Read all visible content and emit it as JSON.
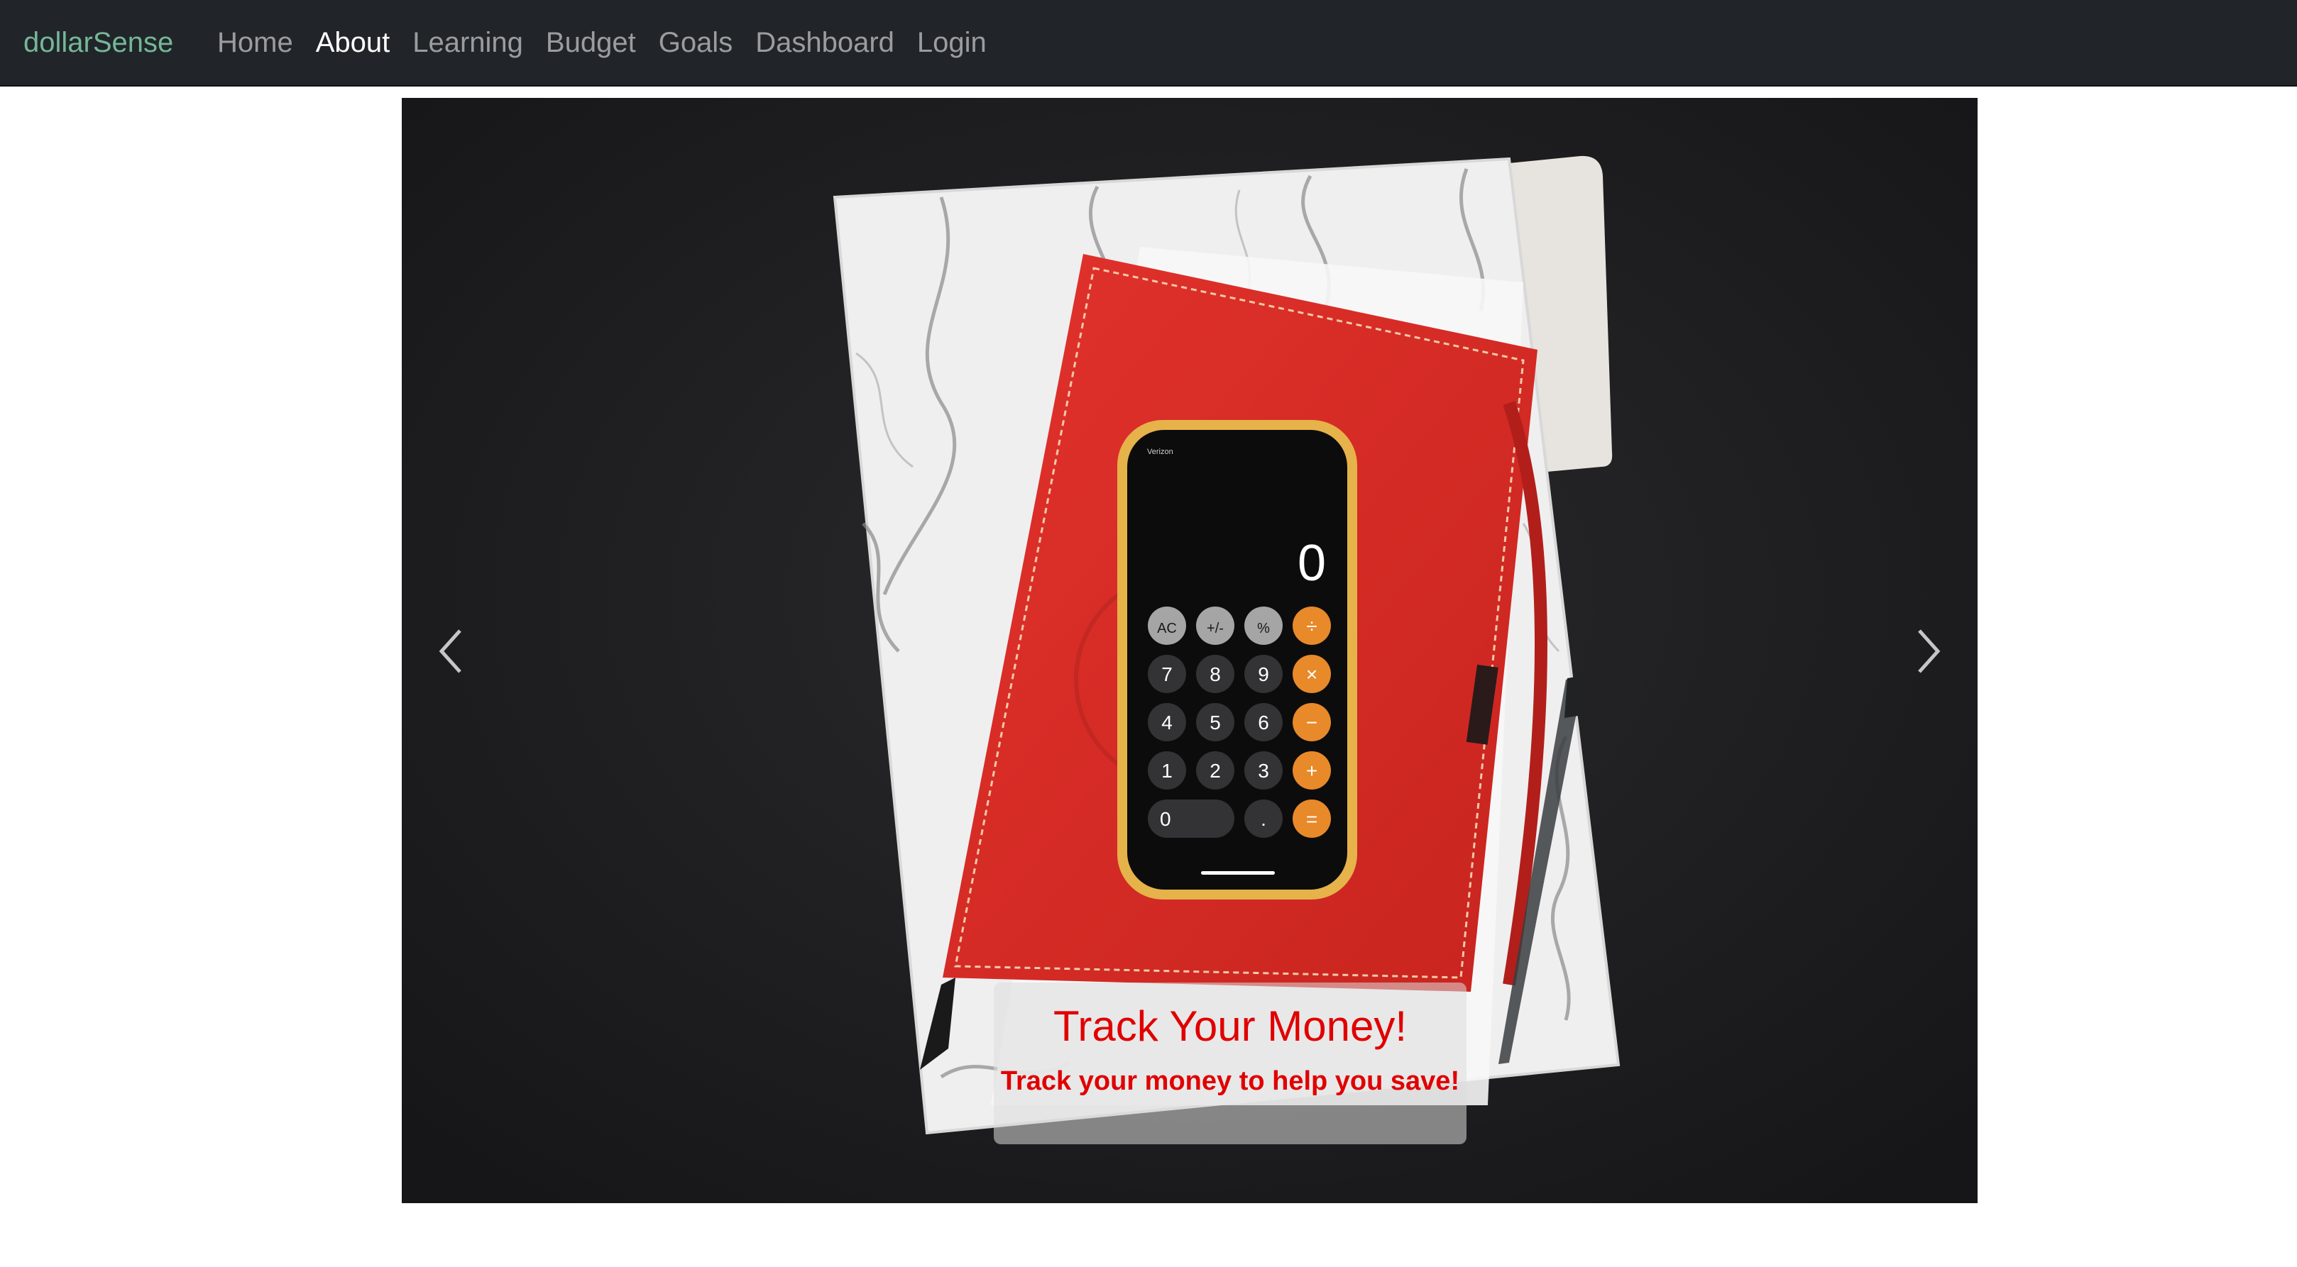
{
  "navbar": {
    "brand": "dollarSense",
    "links": [
      {
        "label": "Home"
      },
      {
        "label": "About",
        "active": true
      },
      {
        "label": "Learning"
      },
      {
        "label": "Budget"
      },
      {
        "label": "Goals"
      },
      {
        "label": "Dashboard"
      },
      {
        "label": "Login"
      }
    ]
  },
  "carousel": {
    "caption_title": "Track Your Money!",
    "caption_text": "Track your money to help you save!",
    "active_slide": 2,
    "slide_count": 3,
    "prev_icon": "chevron-left-icon",
    "next_icon": "chevron-right-icon",
    "phone": {
      "carrier": "Verizon",
      "display": "0",
      "keys": [
        [
          "AC",
          "+/-",
          "%",
          "÷"
        ],
        [
          "7",
          "8",
          "9",
          "×"
        ],
        [
          "4",
          "5",
          "6",
          "−"
        ],
        [
          "1",
          "2",
          "3",
          "+"
        ],
        [
          "0",
          ".",
          "="
        ]
      ]
    }
  },
  "colors": {
    "navbar_bg": "#212529",
    "brand": "#75b798",
    "caption_text": "#e00000",
    "notebook": "#d92b26",
    "calc_orange": "#e8892a"
  }
}
